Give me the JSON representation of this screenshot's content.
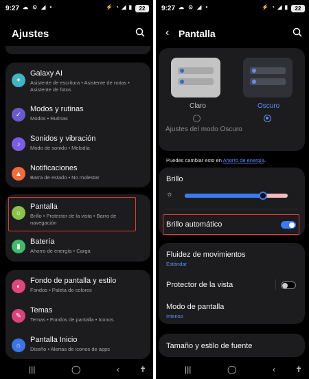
{
  "status": {
    "time": "9:27",
    "battery": "22"
  },
  "left": {
    "title": "Ajustes",
    "groups": [
      [
        {
          "title": "Galaxy AI",
          "subtitle": "Asistente de escritura • Asistente de notas • Asistente de fotos",
          "color": "#3fb4c4",
          "icon": "sparkle-icon"
        },
        {
          "title": "Modos y rutinas",
          "subtitle": "Modos • Rutinas",
          "color": "#6a5acd",
          "icon": "check-circle-icon"
        },
        {
          "title": "Sonidos y vibración",
          "subtitle": "Modo de sonido • Melodía",
          "color": "#7b5de3",
          "icon": "speaker-icon"
        },
        {
          "title": "Notificaciones",
          "subtitle": "Barra de estado • No molestar",
          "color": "#f26b3a",
          "icon": "bell-icon"
        }
      ],
      [
        {
          "title": "Pantalla",
          "subtitle": "Brillo • Protector de la vista • Barra de navegación",
          "color": "#8bc34a",
          "icon": "sun-icon"
        },
        {
          "title": "Batería",
          "subtitle": "Ahorro de energía • Carga",
          "color": "#3dbd6b",
          "icon": "battery-icon"
        }
      ],
      [
        {
          "title": "Fondo de pantalla y estilo",
          "subtitle": "Fondos • Paleta de colores",
          "color": "#e0457b",
          "icon": "palette-icon"
        },
        {
          "title": "Temas",
          "subtitle": "Temas • Fondos de pantalla • Iconos",
          "color": "#d9427a",
          "icon": "brush-icon"
        },
        {
          "title": "Pantalla Inicio",
          "subtitle": "Diseño • Alertas de iconos de apps",
          "color": "#3b74e6",
          "icon": "home-icon"
        }
      ]
    ]
  },
  "right": {
    "title": "Pantalla",
    "themes": {
      "light": "Claro",
      "dark": "Oscuro"
    },
    "dark_settings": "Ajustes del modo Oscuro",
    "hint_prefix": "Puedes cambiar esto en ",
    "hint_link": "Ahorro de energía",
    "hint_suffix": ".",
    "brightness": {
      "label": "Brillo",
      "value": 0.76
    },
    "auto_brightness": {
      "label": "Brillo automático",
      "on": true
    },
    "motion": {
      "title": "Fluidez de movimientos",
      "value": "Estándar"
    },
    "eye_protection": {
      "title": "Protector de la vista",
      "on": false
    },
    "screen_mode": {
      "title": "Modo de pantalla",
      "value": "Intenso"
    },
    "font": {
      "title": "Tamaño y estilo de fuente"
    }
  },
  "colors": {
    "accent": "#5b8ff9",
    "highlight": "#e53935"
  }
}
